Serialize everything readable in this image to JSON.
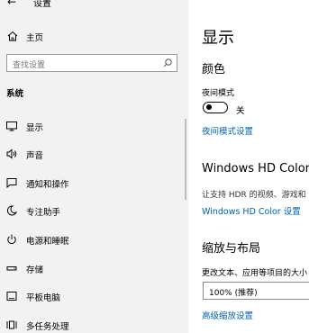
{
  "window": {
    "back_glyph": "←",
    "title": "设置"
  },
  "sidebar": {
    "home_label": "主页",
    "search_placeholder": "查找设置",
    "section_label": "系统",
    "items": [
      {
        "label": "显示",
        "icon": "monitor-icon"
      },
      {
        "label": "声音",
        "icon": "speaker-icon"
      },
      {
        "label": "通知和操作",
        "icon": "notification-icon"
      },
      {
        "label": "专注助手",
        "icon": "moon-icon"
      },
      {
        "label": "电源和睡眠",
        "icon": "power-icon"
      },
      {
        "label": "存储",
        "icon": "storage-icon"
      },
      {
        "label": "平板电脑",
        "icon": "tablet-icon"
      },
      {
        "label": "多任务处理",
        "icon": "multitask-icon"
      }
    ]
  },
  "main": {
    "title": "显示",
    "color_heading": "颜色",
    "night_light_label": "夜间模式",
    "night_light_state": "关",
    "night_light_settings_link": "夜间模式设置",
    "hd_heading": "Windows HD Color",
    "hd_description": "让支持 HDR 的视频、游戏和",
    "hd_link": "Windows HD Color 设置",
    "scale_heading": "缩放与布局",
    "scale_label": "更改文本、应用等项目的大小",
    "scale_value": "100% (推荐)",
    "advanced_scale_link": "高级缩放设置"
  },
  "colors": {
    "accent": "#0063b1",
    "sidebar_bg": "#f2f2f2"
  }
}
